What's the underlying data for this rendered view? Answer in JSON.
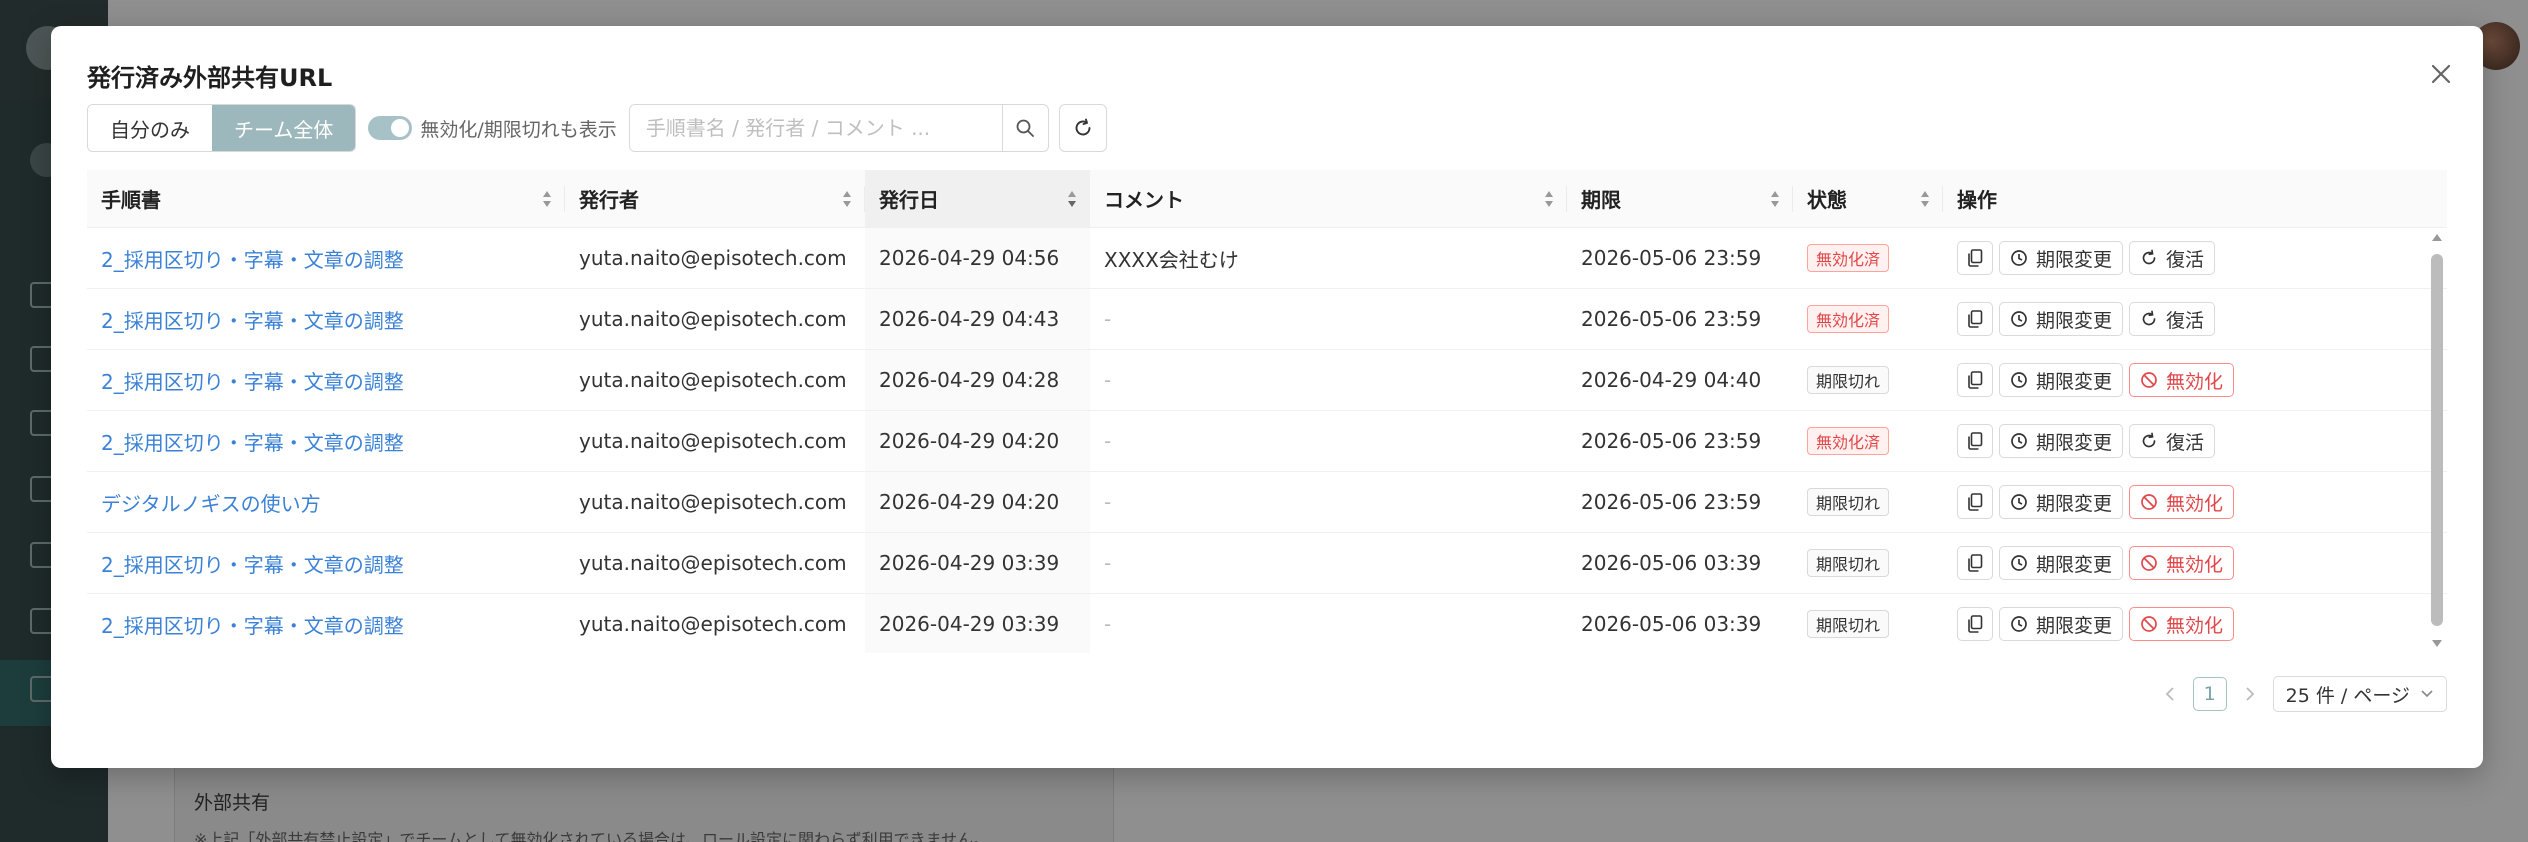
{
  "modal": {
    "title": "発行済み外部共有URL"
  },
  "toolbar": {
    "scope_mine": "自分のみ",
    "scope_team": "チーム全体",
    "toggle_label": "無効化/期限切れも表示",
    "toggle_on": true,
    "search_placeholder": "手順書名 / 発行者 / コメント ...",
    "search_value": ""
  },
  "table": {
    "columns": [
      "手順書",
      "発行者",
      "発行日",
      "コメント",
      "期限",
      "状態",
      "操作"
    ],
    "rows": [
      {
        "doc": "2_採用区切り・字幕・文章の調整",
        "issuer": "yuta.naito@episotech.com",
        "issued": "2026-04-29 04:56",
        "comment": "XXXX会社むけ",
        "expires": "2026-05-06 23:59",
        "status": "無効化済",
        "status_kind": "invalid",
        "action": "復活",
        "action_kind": "restore"
      },
      {
        "doc": "2_採用区切り・字幕・文章の調整",
        "issuer": "yuta.naito@episotech.com",
        "issued": "2026-04-29 04:43",
        "comment": "-",
        "expires": "2026-05-06 23:59",
        "status": "無効化済",
        "status_kind": "invalid",
        "action": "復活",
        "action_kind": "restore"
      },
      {
        "doc": "2_採用区切り・字幕・文章の調整",
        "issuer": "yuta.naito@episotech.com",
        "issued": "2026-04-29 04:28",
        "comment": "-",
        "expires": "2026-04-29 04:40",
        "status": "期限切れ",
        "status_kind": "expired",
        "action": "無効化",
        "action_kind": "disable"
      },
      {
        "doc": "2_採用区切り・字幕・文章の調整",
        "issuer": "yuta.naito@episotech.com",
        "issued": "2026-04-29 04:20",
        "comment": "-",
        "expires": "2026-05-06 23:59",
        "status": "無効化済",
        "status_kind": "invalid",
        "action": "復活",
        "action_kind": "restore"
      },
      {
        "doc": "デジタルノギスの使い方",
        "issuer": "yuta.naito@episotech.com",
        "issued": "2026-04-29 04:20",
        "comment": "-",
        "expires": "2026-05-06 23:59",
        "status": "期限切れ",
        "status_kind": "expired",
        "action": "無効化",
        "action_kind": "disable"
      },
      {
        "doc": "2_採用区切り・字幕・文章の調整",
        "issuer": "yuta.naito@episotech.com",
        "issued": "2026-04-29 03:39",
        "comment": "-",
        "expires": "2026-05-06 03:39",
        "status": "期限切れ",
        "status_kind": "expired",
        "action": "無効化",
        "action_kind": "disable"
      },
      {
        "doc": "2_採用区切り・字幕・文章の調整",
        "issuer": "yuta.naito@episotech.com",
        "issued": "2026-04-29 03:39",
        "comment": "-",
        "expires": "2026-05-06 03:39",
        "status": "期限切れ",
        "status_kind": "expired",
        "action": "無効化",
        "action_kind": "disable"
      }
    ],
    "change_expiry_label": "期限変更"
  },
  "pagination": {
    "current_page": "1",
    "page_size": "25 件 / ページ"
  },
  "background": {
    "section_title": "外部共有",
    "section_note": "※上記「外部共有禁止設定」でチームとして無効化されている場合は、ロール設定に関わらず利用できません。"
  },
  "colors": {
    "accent": "#9db8bd",
    "link": "#3b82d6",
    "danger": "#e0474a"
  }
}
